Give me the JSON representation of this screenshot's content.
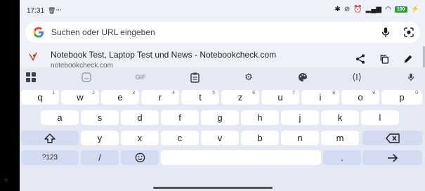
{
  "status": {
    "time": "17:31",
    "battery": "100"
  },
  "search": {
    "placeholder": "Suchen oder URL eingeben"
  },
  "suggestion": {
    "title": "Notebook Test, Laptop Test und News - Notebookcheck.com",
    "url": "notebookcheck.com"
  },
  "keyboard": {
    "toolbar": {
      "gif_label": "GIF"
    },
    "row1": [
      {
        "k": "q",
        "n": "1"
      },
      {
        "k": "w",
        "n": "2"
      },
      {
        "k": "e",
        "n": "3"
      },
      {
        "k": "r",
        "n": "4"
      },
      {
        "k": "t",
        "n": "5"
      },
      {
        "k": "z",
        "n": "6"
      },
      {
        "k": "u",
        "n": "7"
      },
      {
        "k": "i",
        "n": "8"
      },
      {
        "k": "o",
        "n": "9"
      },
      {
        "k": "p",
        "n": "0"
      }
    ],
    "row2": [
      "a",
      "s",
      "d",
      "f",
      "g",
      "h",
      "j",
      "k",
      "l"
    ],
    "row3": [
      "y",
      "x",
      "c",
      "v",
      "b",
      "n",
      "m"
    ],
    "row4": {
      "symbols": "?123",
      "slash": "/",
      "period": "."
    }
  }
}
